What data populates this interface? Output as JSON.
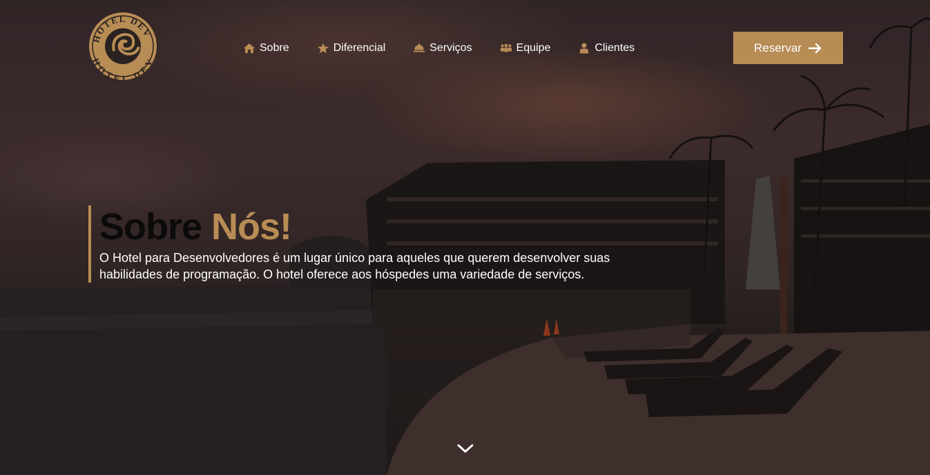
{
  "brand": {
    "logo_text_top": "HOTEL DEV",
    "logo_text_bottom": "HOTEL DEV",
    "accent_color": "#b88c55"
  },
  "nav": {
    "items": [
      {
        "label": "Sobre",
        "icon": "home-icon"
      },
      {
        "label": "Diferencial",
        "icon": "star-icon"
      },
      {
        "label": "Serviços",
        "icon": "bell-icon"
      },
      {
        "label": "Equipe",
        "icon": "group-icon"
      },
      {
        "label": "Clientes",
        "icon": "user-icon"
      }
    ]
  },
  "cta": {
    "label": "Reservar",
    "icon": "arrow-right-icon"
  },
  "about": {
    "title_part1": "Sobre",
    "title_part2": "Nós!",
    "description": "O Hotel para Desenvolvedores é um lugar único para aqueles que querem desenvolver suas habilidades de programação. O hotel oferece aos hóspedes uma variedade de serviços."
  },
  "scroll": {
    "icon": "chevron-down-icon"
  }
}
